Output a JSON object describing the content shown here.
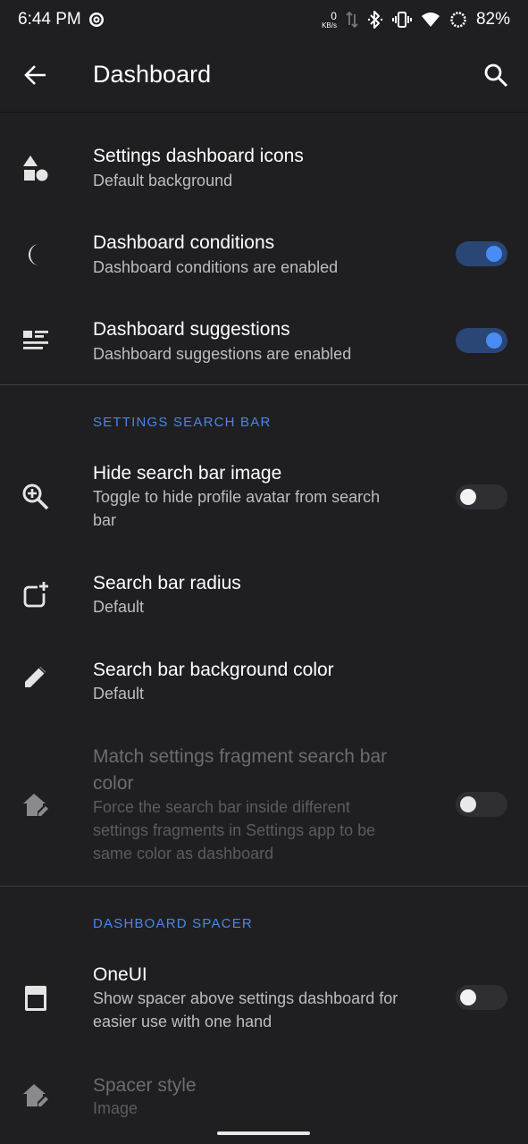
{
  "status_bar": {
    "time": "6:44 PM",
    "net_speed_value": "0",
    "net_speed_unit": "KB/s",
    "battery": "82%",
    "icons": [
      "circle-p-icon",
      "data-arrows-icon",
      "bluetooth-icon",
      "vibrate-icon",
      "wifi-icon",
      "battery-ring-icon"
    ]
  },
  "app_bar": {
    "title": "Dashboard",
    "back_icon": "arrow-back-icon",
    "search_icon": "search-icon"
  },
  "prefs": {
    "dashboard_icons": {
      "title": "Settings dashboard icons",
      "summary": "Default background",
      "icon": "shapes-icon"
    },
    "dashboard_conditions": {
      "title": "Dashboard conditions",
      "summary": "Dashboard conditions are enabled",
      "icon": "moon-icon",
      "toggle": "on"
    },
    "dashboard_suggestions": {
      "title": "Dashboard suggestions",
      "summary": "Dashboard suggestions are enabled",
      "icon": "list-icon",
      "toggle": "on"
    }
  },
  "sections": {
    "search_bar": "SETTINGS SEARCH BAR",
    "spacer": "DASHBOARD SPACER"
  },
  "search_prefs": {
    "hide_image": {
      "title": "Hide search bar image",
      "summary_line1": "Toggle to hide profile avatar from search",
      "summary_line2": "bar",
      "icon": "zoom-in-icon",
      "toggle": "off"
    },
    "radius": {
      "title": "Search bar radius",
      "summary": "Default",
      "icon": "rounded-corner-add-icon"
    },
    "bg_color": {
      "title": "Search bar background color",
      "summary": "Default",
      "icon": "pencil-icon"
    },
    "match_color": {
      "title_line1": "Match settings fragment search bar",
      "title_line2": "color",
      "summary_line1": "Force the search bar inside different",
      "summary_line2": "settings fragments in Settings app to be",
      "summary_line3": "same color as dashboard",
      "icon": "home-edit-icon",
      "toggle": "off",
      "enabled": false
    }
  },
  "spacer_prefs": {
    "oneui": {
      "title": "OneUI",
      "summary_line1": "Show spacer above settings dashboard for",
      "summary_line2": "easier use with one hand",
      "icon": "phone-spacer-icon",
      "toggle": "off"
    },
    "spacer_style": {
      "title": "Spacer style",
      "summary": "Image",
      "icon": "home-edit-icon",
      "enabled": false
    }
  },
  "colors": {
    "background": "#1f1f21",
    "accent": "#4a86e8",
    "toggle_on_track": "#294674",
    "toggle_on_knob": "#4a8cf5"
  }
}
